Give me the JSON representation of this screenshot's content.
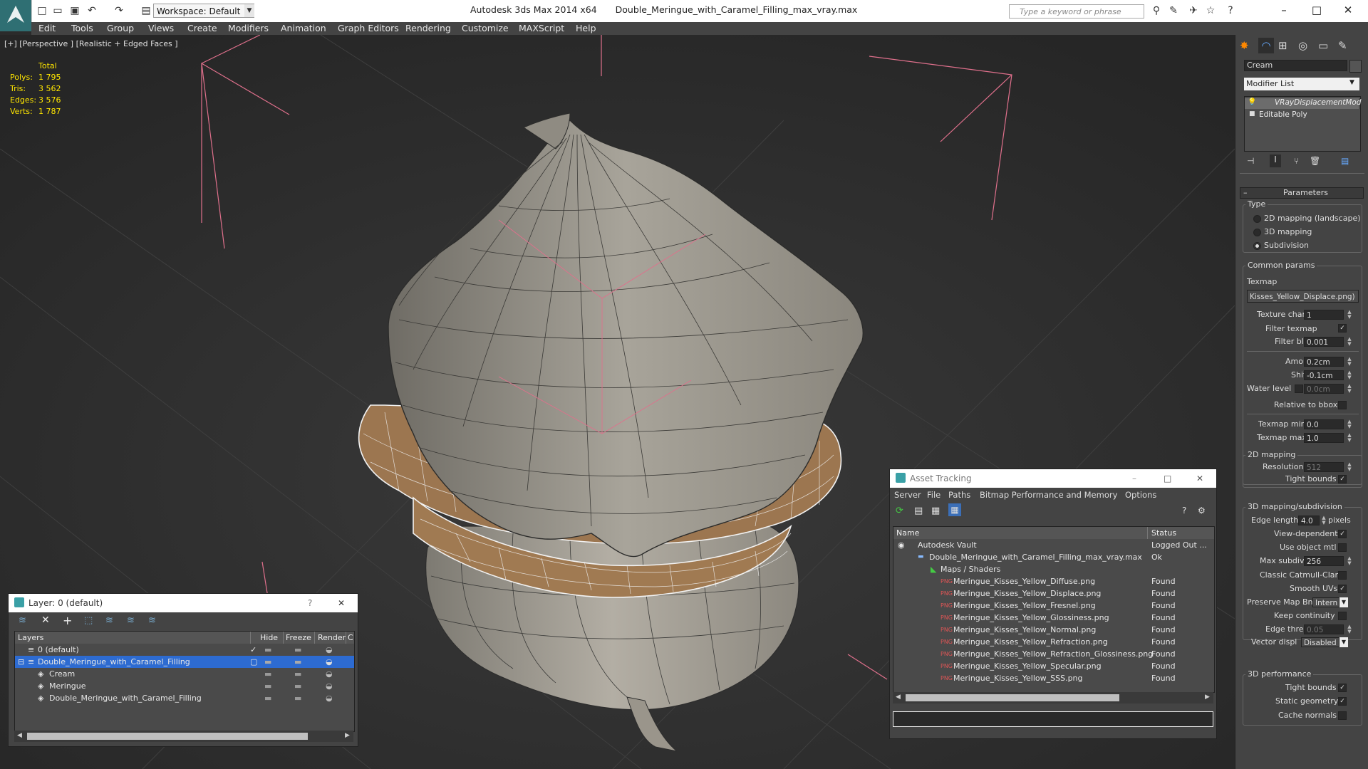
{
  "titlebar": {
    "app_title": "Autodesk 3ds Max  2014 x64",
    "file_name": "Double_Meringue_with_Caramel_Filling_max_vray.max",
    "workspace_label": "Workspace: Default",
    "search_placeholder": "Type a keyword or phrase"
  },
  "menu": {
    "items": [
      "Edit",
      "Tools",
      "Group",
      "Views",
      "Create",
      "Modifiers",
      "Animation",
      "Graph Editors",
      "Rendering",
      "Customize",
      "MAXScript",
      "Help"
    ]
  },
  "viewport": {
    "label": "[+] [Perspective ] [Realistic + Edged Faces ]",
    "stats": {
      "header": "Total",
      "polys_label": "Polys:",
      "polys": "1 795",
      "tris_label": "Tris:",
      "tris": "3 562",
      "edges_label": "Edges:",
      "edges": "3 576",
      "verts_label": "Verts:",
      "verts": "1 787"
    },
    "colors": {
      "mesh": "#9a968c",
      "caramel": "#9c7650",
      "grid": "#3b3b3b",
      "bbox": "#e0708c"
    }
  },
  "layer_panel": {
    "title": "Layer: 0 (default)",
    "help": "?",
    "columns": {
      "layers": "Layers",
      "hide": "Hide",
      "freeze": "Freeze",
      "render": "Render",
      "color": "C"
    },
    "rows": [
      {
        "name": "0 (default)",
        "selected": false
      },
      {
        "name": "Double_Meringue_with_Caramel_Filling",
        "selected": true
      },
      {
        "name": "Cream",
        "selected": false
      },
      {
        "name": "Meringue",
        "selected": false
      },
      {
        "name": "Double_Meringue_with_Caramel_Filling",
        "selected": false
      }
    ]
  },
  "asset_panel": {
    "title": "Asset Tracking",
    "menu": [
      "Server",
      "File",
      "Paths",
      "Bitmap Performance and Memory",
      "Options"
    ],
    "columns": {
      "name": "Name",
      "status": "Status"
    },
    "rows": [
      {
        "name": "Autodesk Vault",
        "status": "Logged Out ..."
      },
      {
        "name": "Double_Meringue_with_Caramel_Filling_max_vray.max",
        "status": "Ok"
      },
      {
        "name": "Maps / Shaders",
        "status": ""
      },
      {
        "name": "Meringue_Kisses_Yellow_Diffuse.png",
        "status": "Found"
      },
      {
        "name": "Meringue_Kisses_Yellow_Displace.png",
        "status": "Found"
      },
      {
        "name": "Meringue_Kisses_Yellow_Fresnel.png",
        "status": "Found"
      },
      {
        "name": "Meringue_Kisses_Yellow_Glossiness.png",
        "status": "Found"
      },
      {
        "name": "Meringue_Kisses_Yellow_Normal.png",
        "status": "Found"
      },
      {
        "name": "Meringue_Kisses_Yellow_Refraction.png",
        "status": "Found"
      },
      {
        "name": "Meringue_Kisses_Yellow_Refraction_Glossiness.png",
        "status": "Found"
      },
      {
        "name": "Meringue_Kisses_Yellow_Specular.png",
        "status": "Found"
      },
      {
        "name": "Meringue_Kisses_Yellow_SSS.png",
        "status": "Found"
      }
    ]
  },
  "command_panel": {
    "object_name": "Cream",
    "modifier_list": "Modifier List",
    "stack": [
      "VRayDisplacementMod",
      "Editable Poly"
    ],
    "parameters_title": "Parameters",
    "type_label": "Type",
    "type_options": [
      "2D mapping (landscape)",
      "3D mapping",
      "Subdivision"
    ],
    "common_params": "Common params",
    "texmap_label": "Texmap",
    "texmap_value": "Kisses_Yellow_Displace.png)",
    "texture_chan_label": "Texture chan",
    "texture_chan": "1",
    "filter_texmap_label": "Filter texmap",
    "filter_blur_label": "Filter blur",
    "filter_blur": "0.001",
    "amount_label": "Amount",
    "amount": "0.2cm",
    "shift_label": "Shift",
    "shift": "-0.1cm",
    "water_level_label": "Water level",
    "water_level": "0.0cm",
    "relative_bbox_label": "Relative to bbox",
    "texmap_min_label": "Texmap min",
    "texmap_min": "0.0",
    "texmap_max_label": "Texmap max",
    "texmap_max": "1.0",
    "mapping2d_title": "2D mapping",
    "resolution_label": "Resolution",
    "resolution": "512",
    "tight_bounds_label": "Tight bounds",
    "mapping3d_title": "3D mapping/subdivision",
    "edge_length_label": "Edge length",
    "edge_length": "4.0",
    "pixels_label": "pixels",
    "view_dependent_label": "View-dependent",
    "use_object_mtl_label": "Use object mtl",
    "max_subdivs_label": "Max subdivs",
    "max_subdivs": "256",
    "classic_cc_label": "Classic Catmull-Clark",
    "smooth_uvs_label": "Smooth UVs",
    "preserve_map_label": "Preserve Map Bnd",
    "preserve_map": "Intern",
    "keep_continuity_label": "Keep continuity",
    "edge_thresh_label": "Edge thresh",
    "edge_thresh": "0.05",
    "vector_displ_label": "Vector displ",
    "vector_displ": "Disabled",
    "perf_title": "3D performance",
    "perf_tight_bounds_label": "Tight bounds",
    "static_geometry_label": "Static geometry",
    "cache_normals_label": "Cache normals"
  }
}
